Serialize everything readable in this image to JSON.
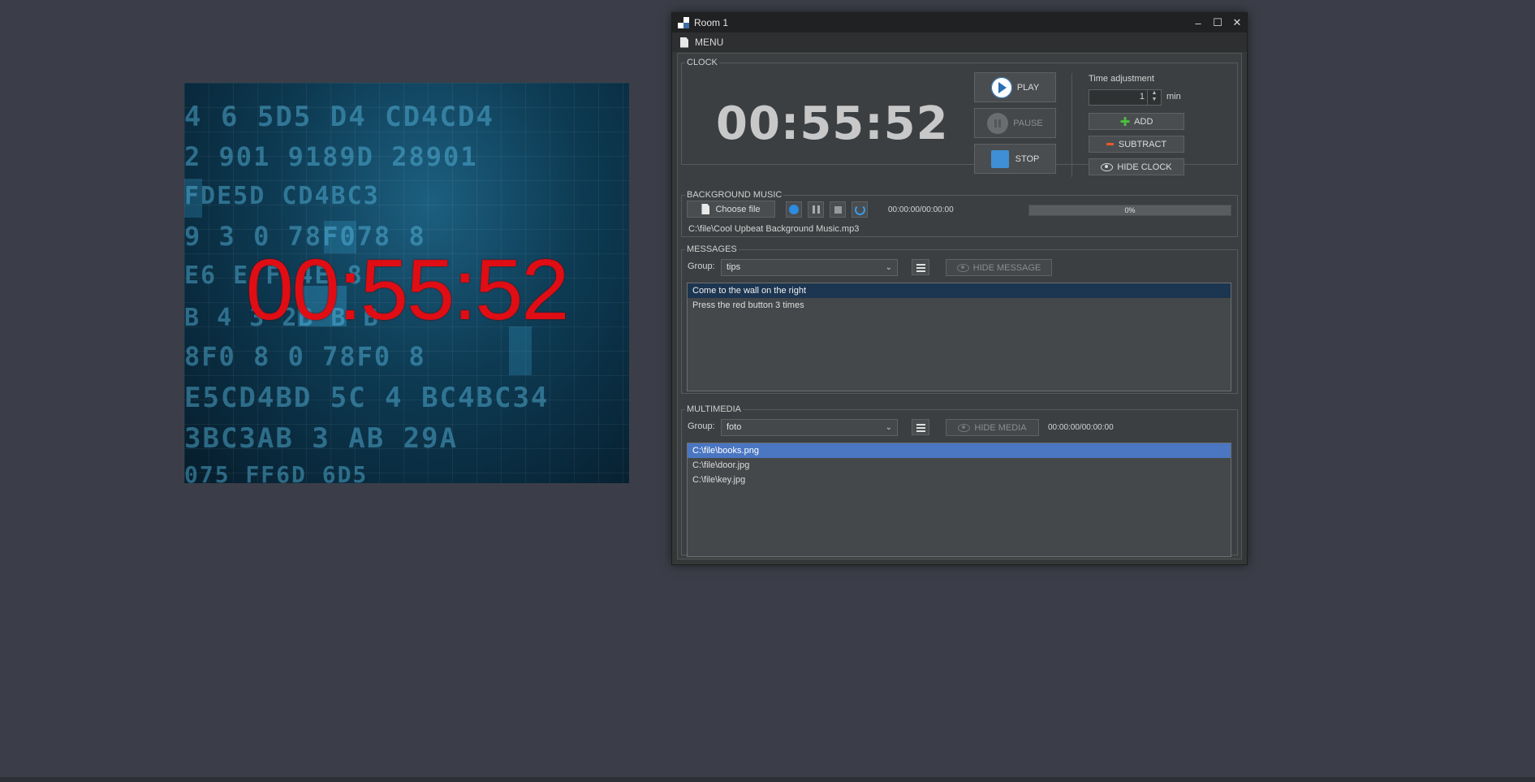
{
  "display": {
    "clock": "00:55:52",
    "code_lines": [
      "4 6 5D5 D4 CD4CD4",
      "2 901 9189D 28901",
      "  FDE5D    CD4BC3",
      "9 3 0   78F078 8",
      " E6 E    F  4E  8",
      "B  4  3  2B  B B",
      "8F0 8 0 78F0 8",
      "E5CD4BD 5C 4 BC4BC34",
      "3BC3AB 3  AB  29A",
      "075  FF6D 6D5"
    ]
  },
  "window": {
    "title": "Room 1",
    "controls": {
      "minimize": "–",
      "maximize": "☐",
      "close": "✕"
    },
    "menu": {
      "label": "MENU"
    }
  },
  "clock": {
    "legend": "CLOCK",
    "time": "00:55:52",
    "play_label": "PLAY",
    "pause_label": "PAUSE",
    "stop_label": "STOP",
    "adjust_label": "Time adjustment",
    "adjust_value": "1",
    "adjust_unit": "min",
    "add_label": "ADD",
    "subtract_label": "SUBTRACT",
    "hide_label": "HIDE CLOCK"
  },
  "music": {
    "legend": "BACKGROUND MUSIC",
    "choose_label": "Choose file",
    "time": "00:00:00/00:00:00",
    "progress_text": "0%",
    "progress": 0,
    "file": "C:\\file\\Cool Upbeat Background Music.mp3"
  },
  "messages": {
    "legend": "MESSAGES",
    "group_label": "Group:",
    "group_value": "tips",
    "hide_label": "HIDE MESSAGE",
    "items": [
      "Come to the wall on the right",
      "Press the red button 3 times"
    ]
  },
  "multimedia": {
    "legend": "MULTIMEDIA",
    "group_label": "Group:",
    "group_value": "foto",
    "hide_label": "HIDE MEDIA",
    "time": "00:00:00/00:00:00",
    "items": [
      "C:\\file\\books.png",
      "C:\\file\\door.jpg",
      "C:\\file\\key.jpg"
    ]
  }
}
